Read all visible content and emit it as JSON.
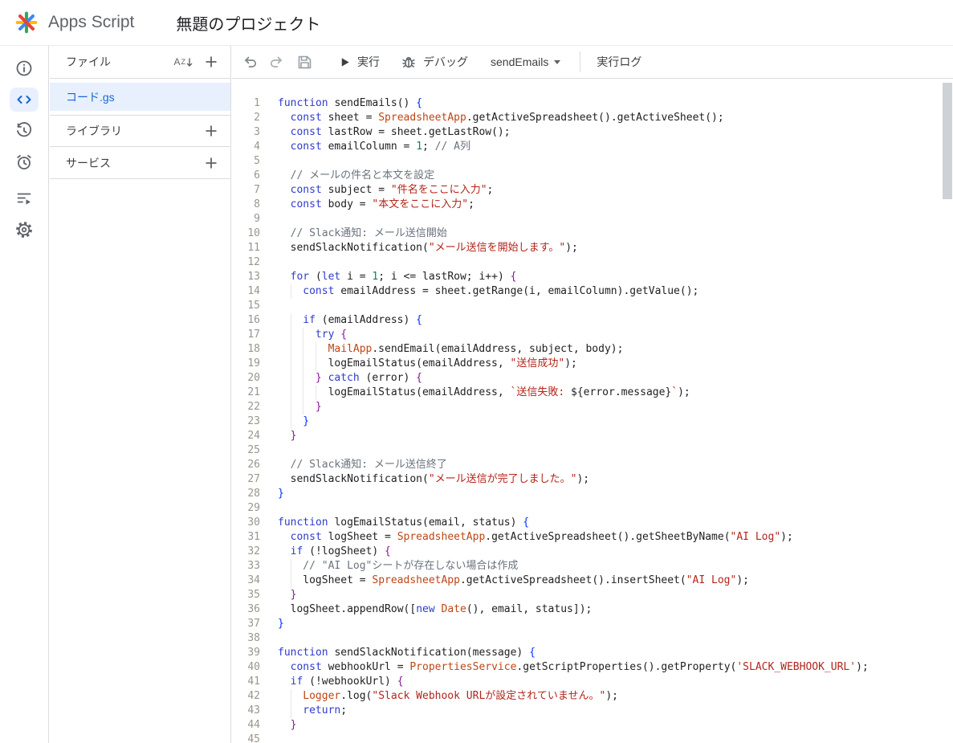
{
  "header": {
    "app_name": "Apps Script",
    "project_title": "無題のプロジェクト"
  },
  "sidebar": {
    "files_header": "ファイル",
    "files": [
      {
        "label": "コード.gs",
        "selected": true
      }
    ],
    "library_label": "ライブラリ",
    "services_label": "サービス"
  },
  "toolbar": {
    "run_label": "実行",
    "debug_label": "デバッグ",
    "function_selected": "sendEmails",
    "log_label": "実行ログ"
  },
  "colors": {
    "accent_blue": "#1967d2",
    "selected_bg": "#e8f0fe",
    "divider": "#dadce0",
    "icon_gray": "#5f6368"
  },
  "editor": {
    "token_colors": {
      "k": "#2f3bcb",
      "s": "#b3251b",
      "v": "#bf4515",
      "c": "#6a737d",
      "n": "#098658",
      "t": "#202124",
      "b1": "#0431fa",
      "b2": "#881798"
    },
    "lines": [
      {
        "n": 1,
        "i": 0,
        "s": [
          [
            "function",
            "k"
          ],
          [
            " sendEmails() ",
            "t"
          ],
          [
            "{",
            "b1"
          ]
        ]
      },
      {
        "n": 2,
        "i": 2,
        "s": [
          [
            "const",
            "k"
          ],
          [
            " sheet = ",
            "t"
          ],
          [
            "SpreadsheetApp",
            "v"
          ],
          [
            ".getActiveSpreadsheet().getActiveSheet();",
            "t"
          ]
        ]
      },
      {
        "n": 3,
        "i": 2,
        "s": [
          [
            "const",
            "k"
          ],
          [
            " lastRow = sheet.getLastRow();",
            "t"
          ]
        ]
      },
      {
        "n": 4,
        "i": 2,
        "s": [
          [
            "const",
            "k"
          ],
          [
            " emailColumn = ",
            "t"
          ],
          [
            "1",
            "n"
          ],
          [
            "; ",
            "t"
          ],
          [
            "// A列",
            "c"
          ]
        ]
      },
      {
        "n": 5,
        "i": 0,
        "s": []
      },
      {
        "n": 6,
        "i": 2,
        "s": [
          [
            "// メールの件名と本文を設定",
            "c"
          ]
        ]
      },
      {
        "n": 7,
        "i": 2,
        "s": [
          [
            "const",
            "k"
          ],
          [
            " subject = ",
            "t"
          ],
          [
            "\"件名をここに入力\"",
            "s"
          ],
          [
            ";",
            "t"
          ]
        ]
      },
      {
        "n": 8,
        "i": 2,
        "s": [
          [
            "const",
            "k"
          ],
          [
            " body = ",
            "t"
          ],
          [
            "\"本文をここに入力\"",
            "s"
          ],
          [
            ";",
            "t"
          ]
        ]
      },
      {
        "n": 9,
        "i": 0,
        "s": []
      },
      {
        "n": 10,
        "i": 2,
        "s": [
          [
            "// Slack通知: メール送信開始",
            "c"
          ]
        ]
      },
      {
        "n": 11,
        "i": 2,
        "s": [
          [
            "sendSlackNotification(",
            "t"
          ],
          [
            "\"メール送信を開始します。\"",
            "s"
          ],
          [
            ");",
            "t"
          ]
        ]
      },
      {
        "n": 12,
        "i": 0,
        "s": []
      },
      {
        "n": 13,
        "i": 2,
        "s": [
          [
            "for",
            "k"
          ],
          [
            " (",
            "t"
          ],
          [
            "let",
            "k"
          ],
          [
            " i = ",
            "t"
          ],
          [
            "1",
            "n"
          ],
          [
            "; i <= lastRow; i++) ",
            "t"
          ],
          [
            "{",
            "b2"
          ]
        ]
      },
      {
        "n": 14,
        "i": 4,
        "s": [
          [
            "const",
            "k"
          ],
          [
            " emailAddress = sheet.getRange(i, emailColumn).getValue();",
            "t"
          ]
        ]
      },
      {
        "n": 15,
        "i": 0,
        "s": []
      },
      {
        "n": 16,
        "i": 4,
        "s": [
          [
            "if",
            "k"
          ],
          [
            " (emailAddress) ",
            "t"
          ],
          [
            "{",
            "b1"
          ]
        ]
      },
      {
        "n": 17,
        "i": 6,
        "s": [
          [
            "try",
            "k"
          ],
          [
            " ",
            "t"
          ],
          [
            "{",
            "b2"
          ]
        ]
      },
      {
        "n": 18,
        "i": 8,
        "s": [
          [
            "MailApp",
            "v"
          ],
          [
            ".sendEmail(emailAddress, subject, body);",
            "t"
          ]
        ]
      },
      {
        "n": 19,
        "i": 8,
        "s": [
          [
            "logEmailStatus(emailAddress, ",
            "t"
          ],
          [
            "\"送信成功\"",
            "s"
          ],
          [
            ");",
            "t"
          ]
        ]
      },
      {
        "n": 20,
        "i": 6,
        "s": [
          [
            "}",
            "b2"
          ],
          [
            " ",
            "t"
          ],
          [
            "catch",
            "k"
          ],
          [
            " (error) ",
            "t"
          ],
          [
            "{",
            "b2"
          ]
        ]
      },
      {
        "n": 21,
        "i": 8,
        "s": [
          [
            "logEmailStatus(emailAddress, ",
            "t"
          ],
          [
            "`送信失敗: ",
            "s"
          ],
          [
            "${error.message}",
            "t"
          ],
          [
            "`",
            "s"
          ],
          [
            ");",
            "t"
          ]
        ]
      },
      {
        "n": 22,
        "i": 6,
        "s": [
          [
            "}",
            "b2"
          ]
        ]
      },
      {
        "n": 23,
        "i": 4,
        "s": [
          [
            "}",
            "b1"
          ]
        ]
      },
      {
        "n": 24,
        "i": 2,
        "s": [
          [
            "}",
            "b2"
          ]
        ]
      },
      {
        "n": 25,
        "i": 0,
        "s": []
      },
      {
        "n": 26,
        "i": 2,
        "s": [
          [
            "// Slack通知: メール送信終了",
            "c"
          ]
        ]
      },
      {
        "n": 27,
        "i": 2,
        "s": [
          [
            "sendSlackNotification(",
            "t"
          ],
          [
            "\"メール送信が完了しました。\"",
            "s"
          ],
          [
            ");",
            "t"
          ]
        ]
      },
      {
        "n": 28,
        "i": 0,
        "s": [
          [
            "}",
            "b1"
          ]
        ]
      },
      {
        "n": 29,
        "i": 0,
        "s": []
      },
      {
        "n": 30,
        "i": 0,
        "s": [
          [
            "function",
            "k"
          ],
          [
            " logEmailStatus(email, status) ",
            "t"
          ],
          [
            "{",
            "b1"
          ]
        ]
      },
      {
        "n": 31,
        "i": 2,
        "s": [
          [
            "const",
            "k"
          ],
          [
            " logSheet = ",
            "t"
          ],
          [
            "SpreadsheetApp",
            "v"
          ],
          [
            ".getActiveSpreadsheet().getSheetByName(",
            "t"
          ],
          [
            "\"AI Log\"",
            "s"
          ],
          [
            ");",
            "t"
          ]
        ]
      },
      {
        "n": 32,
        "i": 2,
        "s": [
          [
            "if",
            "k"
          ],
          [
            " (!logSheet) ",
            "t"
          ],
          [
            "{",
            "b2"
          ]
        ]
      },
      {
        "n": 33,
        "i": 4,
        "s": [
          [
            "// \"AI Log\"シートが存在しない場合は作成",
            "c"
          ]
        ]
      },
      {
        "n": 34,
        "i": 4,
        "s": [
          [
            "logSheet = ",
            "t"
          ],
          [
            "SpreadsheetApp",
            "v"
          ],
          [
            ".getActiveSpreadsheet().insertSheet(",
            "t"
          ],
          [
            "\"AI Log\"",
            "s"
          ],
          [
            ");",
            "t"
          ]
        ]
      },
      {
        "n": 35,
        "i": 2,
        "s": [
          [
            "}",
            "b2"
          ]
        ]
      },
      {
        "n": 36,
        "i": 2,
        "s": [
          [
            "logSheet.appendRow([",
            "t"
          ],
          [
            "new",
            "k"
          ],
          [
            " ",
            "t"
          ],
          [
            "Date",
            "v"
          ],
          [
            "(), email, status]);",
            "t"
          ]
        ]
      },
      {
        "n": 37,
        "i": 0,
        "s": [
          [
            "}",
            "b1"
          ]
        ]
      },
      {
        "n": 38,
        "i": 0,
        "s": []
      },
      {
        "n": 39,
        "i": 0,
        "s": [
          [
            "function",
            "k"
          ],
          [
            " sendSlackNotification(message) ",
            "t"
          ],
          [
            "{",
            "b1"
          ]
        ]
      },
      {
        "n": 40,
        "i": 2,
        "s": [
          [
            "const",
            "k"
          ],
          [
            " webhookUrl = ",
            "t"
          ],
          [
            "PropertiesService",
            "v"
          ],
          [
            ".getScriptProperties().getProperty(",
            "t"
          ],
          [
            "'SLACK_WEBHOOK_URL'",
            "s"
          ],
          [
            ");",
            "t"
          ]
        ]
      },
      {
        "n": 41,
        "i": 2,
        "s": [
          [
            "if",
            "k"
          ],
          [
            " (!webhookUrl) ",
            "t"
          ],
          [
            "{",
            "b2"
          ]
        ]
      },
      {
        "n": 42,
        "i": 4,
        "s": [
          [
            "Logger",
            "v"
          ],
          [
            ".log(",
            "t"
          ],
          [
            "\"Slack Webhook URLが設定されていません。\"",
            "s"
          ],
          [
            ");",
            "t"
          ]
        ]
      },
      {
        "n": 43,
        "i": 4,
        "s": [
          [
            "return",
            "k"
          ],
          [
            ";",
            "t"
          ]
        ]
      },
      {
        "n": 44,
        "i": 2,
        "s": [
          [
            "}",
            "b2"
          ]
        ]
      },
      {
        "n": 45,
        "i": 0,
        "s": []
      }
    ]
  }
}
